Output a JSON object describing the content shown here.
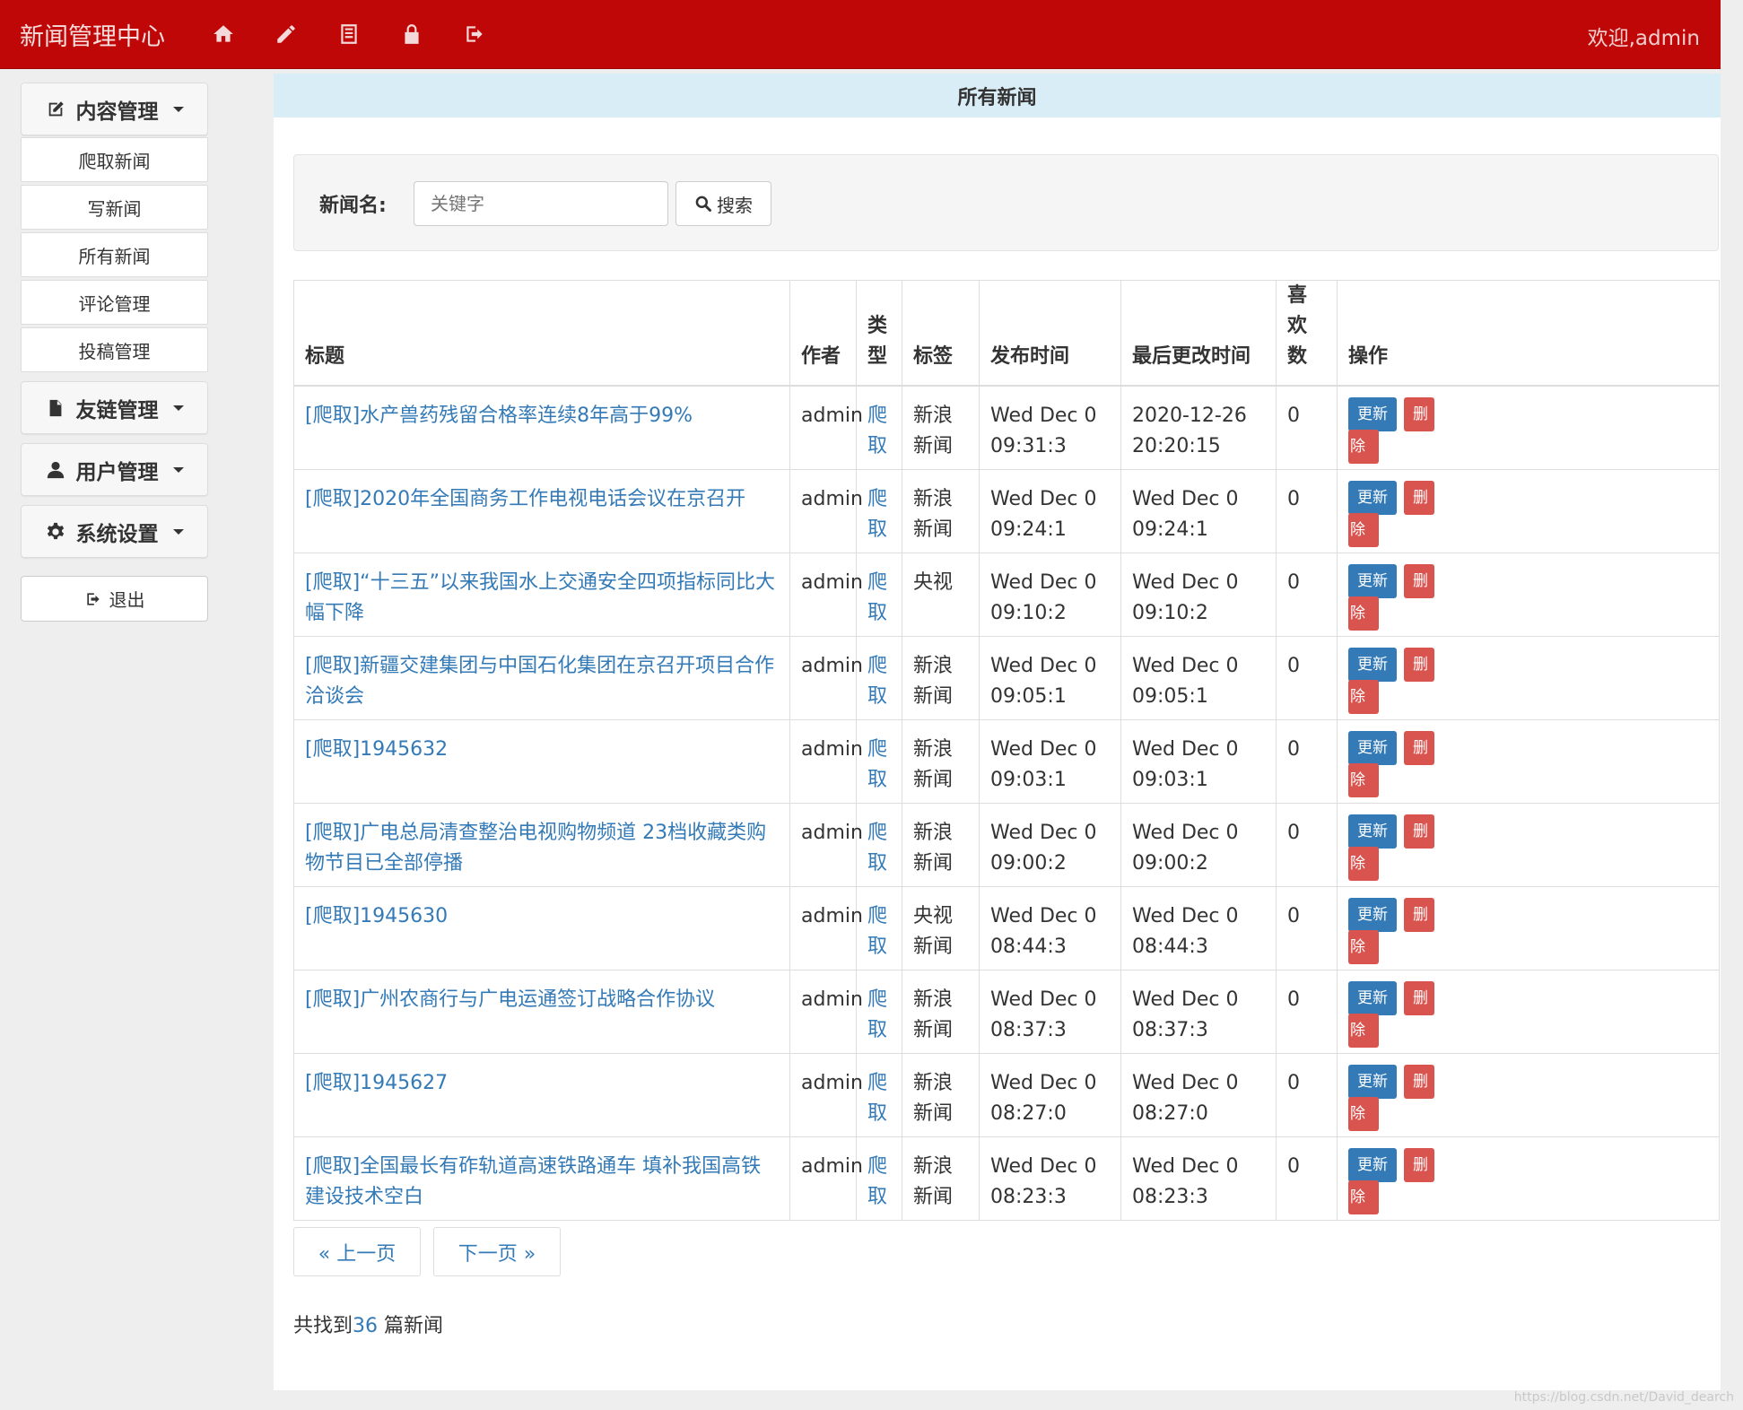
{
  "navbar": {
    "brand": "新闻管理中心",
    "icons": [
      "home-icon",
      "pencil-icon",
      "list-icon",
      "lock-icon",
      "logout-icon"
    ],
    "welcome": "欢迎,admin"
  },
  "sidebar": {
    "groups": [
      {
        "label": "内容管理",
        "icon": "edit-icon"
      },
      {
        "label": "友链管理",
        "icon": "file-icon"
      },
      {
        "label": "用户管理",
        "icon": "user-icon"
      },
      {
        "label": "系统设置",
        "icon": "gear-icon"
      }
    ],
    "content_items": [
      "爬取新闻",
      "写新闻",
      "所有新闻",
      "评论管理",
      "投稿管理"
    ],
    "logout": "退出"
  },
  "main": {
    "heading": "所有新闻",
    "search": {
      "label": "新闻名:",
      "placeholder": "关键字",
      "button": "搜索"
    },
    "columns": [
      "标题",
      "作者",
      "类型",
      "标签",
      "发布时间",
      "最后更改时间",
      "喜欢数",
      "操作"
    ],
    "rows": [
      {
        "title": "[爬取]水产兽药残留合格率连续8年高于99%",
        "author": "admin",
        "type": "爬取",
        "tag": "新浪新闻",
        "published": "Wed Dec 0 09:31:3",
        "modified": "2020-12-26 20:20:15",
        "likes": "0"
      },
      {
        "title": "[爬取]2020年全国商务工作电视电话会议在京召开",
        "author": "admin",
        "type": "爬取",
        "tag": "新浪新闻",
        "published": "Wed Dec 0 09:24:1",
        "modified": "Wed Dec 0 09:24:1",
        "likes": "0"
      },
      {
        "title": "[爬取]“十三五”以来我国水上交通安全四项指标同比大幅下降",
        "author": "admin",
        "type": "爬取",
        "tag": "央视",
        "published": "Wed Dec 0 09:10:2",
        "modified": "Wed Dec 0 09:10:2",
        "likes": "0"
      },
      {
        "title": "[爬取]新疆交建集团与中国石化集团在京召开项目合作洽谈会",
        "author": "admin",
        "type": "爬取",
        "tag": "新浪新闻",
        "published": "Wed Dec 0 09:05:1",
        "modified": "Wed Dec 0 09:05:1",
        "likes": "0"
      },
      {
        "title": "[爬取]1945632",
        "author": "admin",
        "type": "爬取",
        "tag": "新浪新闻",
        "published": "Wed Dec 0 09:03:1",
        "modified": "Wed Dec 0 09:03:1",
        "likes": "0"
      },
      {
        "title": "[爬取]广电总局清查整治电视购物频道 23档收藏类购物节目已全部停播",
        "author": "admin",
        "type": "爬取",
        "tag": "新浪新闻",
        "published": "Wed Dec 0 09:00:2",
        "modified": "Wed Dec 0 09:00:2",
        "likes": "0"
      },
      {
        "title": "[爬取]1945630",
        "author": "admin",
        "type": "爬取",
        "tag": "央视新闻",
        "published": "Wed Dec 0 08:44:3",
        "modified": "Wed Dec 0 08:44:3",
        "likes": "0"
      },
      {
        "title": "[爬取]广州农商行与广电运通签订战略合作协议",
        "author": "admin",
        "type": "爬取",
        "tag": "新浪新闻",
        "published": "Wed Dec 0 08:37:3",
        "modified": "Wed Dec 0 08:37:3",
        "likes": "0"
      },
      {
        "title": "[爬取]1945627",
        "author": "admin",
        "type": "爬取",
        "tag": "新浪新闻",
        "published": "Wed Dec 0 08:27:0",
        "modified": "Wed Dec 0 08:27:0",
        "likes": "0"
      },
      {
        "title": "[爬取]全国最长有砟轨道高速铁路通车 填补我国高铁建设技术空白",
        "author": "admin",
        "type": "爬取",
        "tag": "新浪新闻",
        "published": "Wed Dec 0 08:23:3",
        "modified": "Wed Dec 0 08:23:3",
        "likes": "0"
      }
    ],
    "actions": {
      "update": "更新",
      "delete_1": "删",
      "delete_2": "除"
    },
    "pager": {
      "prev": "« 上一页",
      "next": "下一页 »"
    },
    "result": {
      "prefix": "共找到",
      "count": "36",
      "suffix": " 篇新闻"
    }
  },
  "watermark": "https://blog.csdn.net/David_dearch"
}
